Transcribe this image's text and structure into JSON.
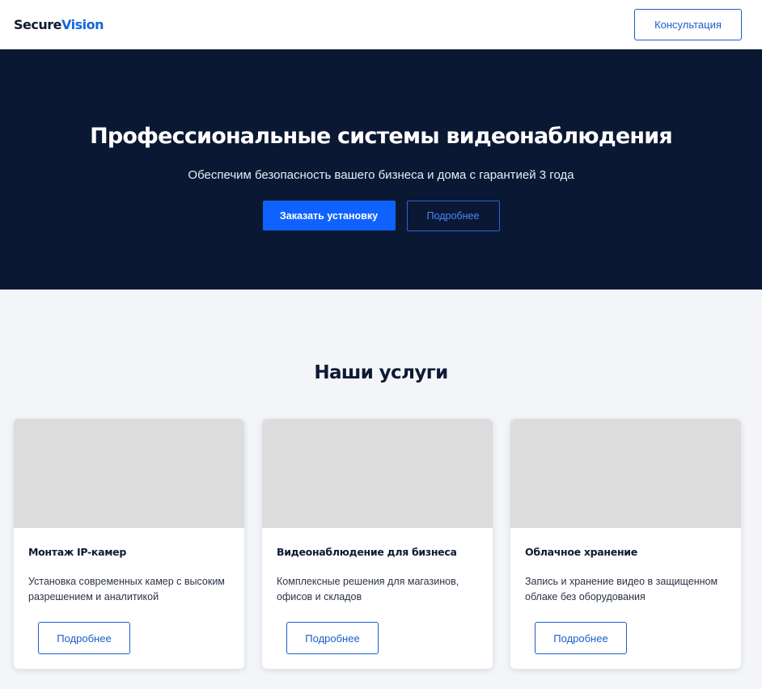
{
  "header": {
    "logo_primary": "Secure",
    "logo_accent": "Vision",
    "consult_label": "Консультация"
  },
  "hero": {
    "title": "Профессиональные системы видеонаблюдения",
    "subtitle": "Обеспечим безопасность вашего бизнеса и дома с гарантией 3 года",
    "primary_label": "Заказать установку",
    "secondary_label": "Подробнее"
  },
  "services": {
    "title": "Наши услуги",
    "cards": [
      {
        "title": "Монтаж IP-камер",
        "description": "Установка современных камер с высоким разрешением и аналитикой",
        "button_label": "Подробнее"
      },
      {
        "title": "Видеонаблюдение для бизнеса",
        "description": "Комплексные решения для магазинов, офисов и складов",
        "button_label": "Подробнее"
      },
      {
        "title": "Облачное хранение",
        "description": "Запись и хранение видео в защищенном облаке без оборудования",
        "button_label": "Подробнее"
      }
    ]
  },
  "colors": {
    "accent": "#0f62fe",
    "hero_background": "#0b1833",
    "page_background": "#f3f5f9"
  }
}
